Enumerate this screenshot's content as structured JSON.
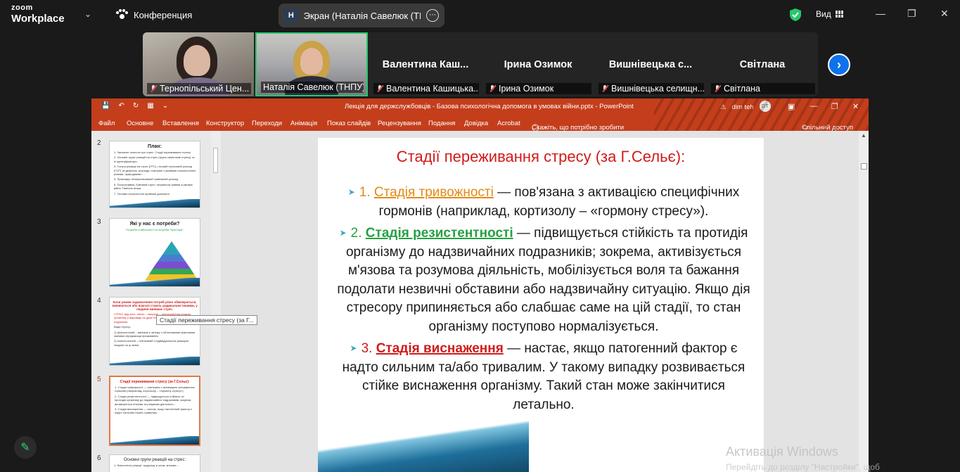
{
  "zoom": {
    "logo_top": "zoom",
    "logo_bottom": "Workplace",
    "meeting_label": "Конференция",
    "screen_badge_letter": "Н",
    "screen_share_label": "Экран (Наталія Савелюк (ТНПУ",
    "view_label": "Вид",
    "accent_color": "#0e72ed"
  },
  "participants": [
    {
      "name": "Тернопільський Цен...",
      "muted": true,
      "video": true
    },
    {
      "name": "Наталія Савелюк (ТНПУ)",
      "muted": false,
      "video": true,
      "active_speaker": true
    },
    {
      "display_name": "Валентина  Каш...",
      "name": "Валентина Кашицька...",
      "muted": true,
      "video": false
    },
    {
      "display_name": "Ірина Озимок",
      "name": "Ірина Озимок",
      "muted": true,
      "video": false
    },
    {
      "display_name": "Вишнівецька с...",
      "name": "Вишнівецька селищн...",
      "muted": true,
      "video": false
    },
    {
      "display_name": "Світлана",
      "name": "Світлана",
      "muted": true,
      "video": false
    }
  ],
  "powerpoint": {
    "document_title": "Лекція для держслужбовців - Базова психологічна допомога в умовах війни.pptx  -  PowerPoint",
    "user_name": "dim teh",
    "user_initials": "DT",
    "brand_color": "#c43e1c",
    "menu": [
      "Файл",
      "Основне",
      "Вставлення",
      "Конструктор",
      "Переходи",
      "Анімація",
      "Показ слайдів",
      "Рецензування",
      "Подання",
      "Довідка",
      "Acrobat",
      "Скажіть, що потрібно зробити",
      "Спільний доступ"
    ],
    "thumbnails": [
      {
        "number": "2",
        "title": "План:",
        "lines": [
          "1. Загальне поняття про стрес. Стадії переживання стресу.",
          "2. Основні групи реакцій на стрес (групи симптомів стресу) та їх ідентифікатори.",
          "3. Гостра реакція на стрес (ГРС), гострий стресовий розлад (ГСР) та депресія, розлади, пов'язані з умовами психологічних ризиків, природними і ...",
          "5. Приклади: генералізований тривожний розлад.",
          "6. Психотравма. Бойовий стрес і моральна травма в умовах війни. Панічна атака.",
          "7. Основні психологічні прийоми допомоги."
        ]
      },
      {
        "number": "3",
        "title": "Які у нас є потреби?",
        "lines": [
          "Потреба стабільності та потреба \"простору\"."
        ]
      },
      {
        "number": "4",
        "title": "Коли умови задоволення потреб різко обмежуються, змінюються або взагалі стають радикально іншими, у людини виникає стрес.",
        "lines": [
          "СТРЕС (від англ. stress – напруга) – неспецифічна реакція організму у відповідь на дуже інтенсивний або незвичний подразник.",
          "Види стресу:",
          "1) фізіологічний – виникає у зв'язку з об'єктивними фізичними змінами середовища проживання;",
          "2) психологічний – пов'язаний з індивідуальною реакцією людини на ці зміни."
        ]
      },
      {
        "number": "5",
        "title": "Стадії переживання стресу (за Г.Сельє):",
        "lines": [
          "1. Стадія тривожності — пов'язана з активацією специфічних гормонів (наприклад, кортизолу – «гормону стресу»).",
          "2. Стадія резистентності — підвищується стійкість та протидія організму до надзвичайних подразників; зокрема, активізується м'язова та розумова діяльність...",
          "3. Стадія виснаження — настає, якщо патогенний фактор є надто сильним та/або тривалим."
        ],
        "active": true
      },
      {
        "number": "6",
        "title": "Основні групи реакцій на стрес:",
        "lines": [
          "1. Фізіологічні реакції: труднощі зі сном, м'язова ..."
        ]
      }
    ],
    "tooltip": "Стадії переживання стресу (за Г..."
  },
  "slide": {
    "title": "Стадії переживання стресу (за Г.Сельє):",
    "items": [
      {
        "num": "1.",
        "term": "Стадія тривожності",
        "dash": "—",
        "text_a": "пов'язана з активацією специфічних гормонів (наприклад, кортизолу – «гормону стресу»).",
        "color": "#e38a15"
      },
      {
        "num": "2.",
        "term": "Стадія резистентності",
        "dash": "—",
        "text_a": "підвищується стійкість та протидія організму до надзвичайних подразників; зокрема, активізується м'язова та розумова діяльність, мобілізується воля та бажання подолати незвичні обставини або надзвичайну ситуацію. Якщо дія стресору припиняється або слабшає саме на цій стадії, то стан організму поступово нормалізується.",
        "color": "#27a042"
      },
      {
        "num": "3.",
        "term": "Стадія виснаження",
        "dash": "—",
        "text_a": "настає, якщо патогенний фактор є надто сильним та/або тривалим. У такому випадку розвивається стійке виснаження організму. Такий стан може закінчитися летально.",
        "color": "#d01b1b"
      }
    ]
  },
  "windows": {
    "activation_title": "Активація Windows",
    "activation_sub": "Перейдіть до розділу \"Настройки\", щоб"
  }
}
